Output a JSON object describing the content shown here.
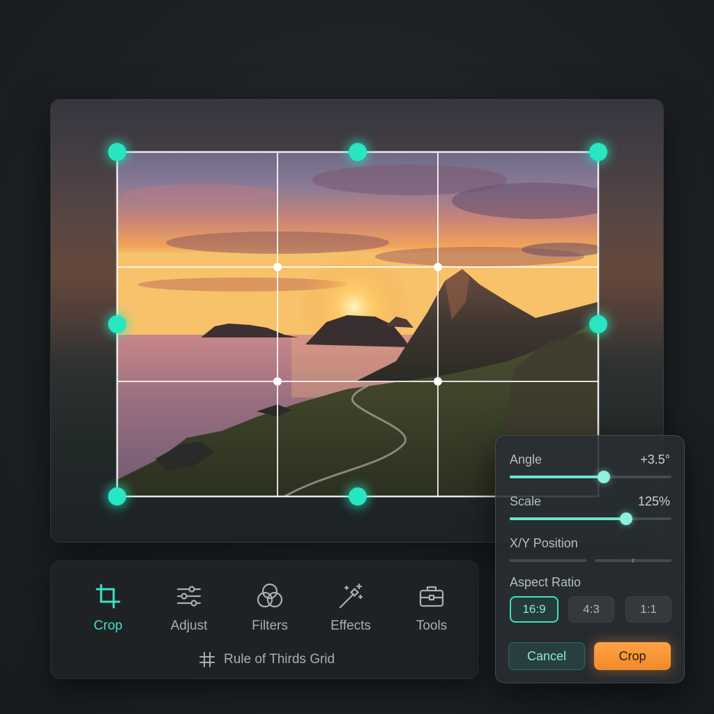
{
  "colors": {
    "accent": "#27e6c0",
    "crop_button": "#f8962f",
    "background": "#1e2226"
  },
  "toolbar": {
    "tools": [
      {
        "label": "Crop",
        "icon": "crop-icon",
        "active": true
      },
      {
        "label": "Adjust",
        "icon": "sliders-icon",
        "active": false
      },
      {
        "label": "Filters",
        "icon": "filters-icon",
        "active": false
      },
      {
        "label": "Effects",
        "icon": "magic-wand-icon",
        "active": false
      },
      {
        "label": "Tools",
        "icon": "toolbox-icon",
        "active": false
      }
    ],
    "grid_toggle": {
      "label": "Rule of Thirds Grid",
      "icon": "grid-icon"
    }
  },
  "panel": {
    "angle": {
      "label": "Angle",
      "value": "+3.5°",
      "level": 0.58
    },
    "scale": {
      "label": "Scale",
      "value": "125%",
      "level": 0.72
    },
    "position": {
      "label": "X/Y Position"
    },
    "aspect": {
      "label": "Aspect Ratio",
      "options": [
        "16:9",
        "4:3",
        "1:1"
      ],
      "selected": "16:9"
    },
    "cancel_label": "Cancel",
    "crop_label": "Crop"
  }
}
